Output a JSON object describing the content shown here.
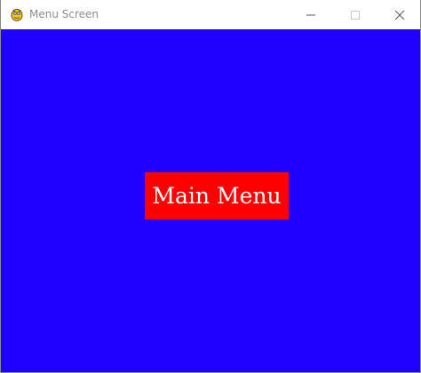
{
  "window": {
    "title": "Menu Screen",
    "app_icon": "pygame-snake-icon",
    "controls": {
      "minimize_icon": "minimize-icon",
      "maximize_icon": "maximize-icon",
      "close_icon": "close-icon"
    }
  },
  "canvas": {
    "background_color": "#1f00ff",
    "main_menu_button": {
      "label": "Main Menu",
      "background_color": "#ff0000",
      "text_color": "#ffffff"
    }
  }
}
